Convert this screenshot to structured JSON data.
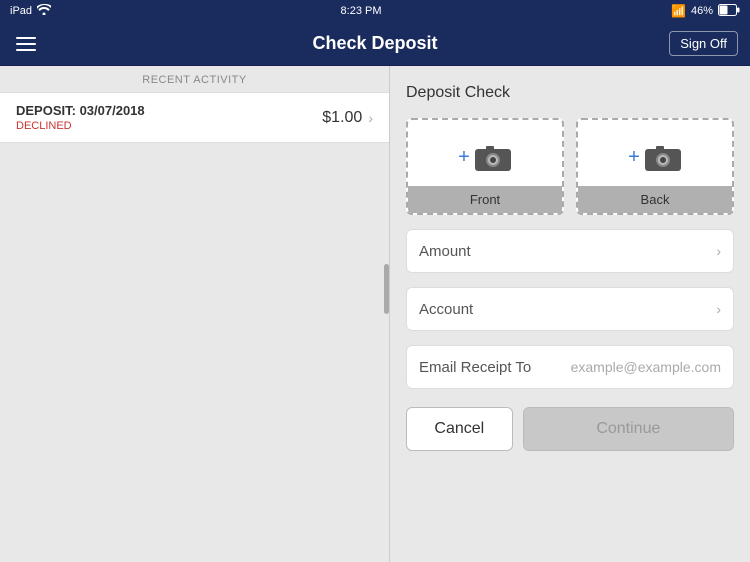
{
  "statusBar": {
    "carrier": "iPad",
    "wifi": true,
    "time": "8:23 PM",
    "bluetooth": true,
    "battery": "46%"
  },
  "header": {
    "title": "Check Deposit",
    "menuIcon": "☰",
    "signOffLabel": "Sign Off"
  },
  "leftPanel": {
    "recentActivityLabel": "RECENT ACTIVITY",
    "activityItem": {
      "depositLabel": "DEPOSIT:  03/07/2018",
      "status": "DECLINED",
      "amount": "$1.00"
    }
  },
  "rightPanel": {
    "title": "Deposit Check",
    "frontLabel": "Front",
    "backLabel": "Back",
    "amountLabel": "Amount",
    "accountLabel": "Account",
    "emailLabel": "Email Receipt To",
    "emailPlaceholder": "example@example.com",
    "cancelLabel": "Cancel",
    "continueLabel": "Continue"
  }
}
